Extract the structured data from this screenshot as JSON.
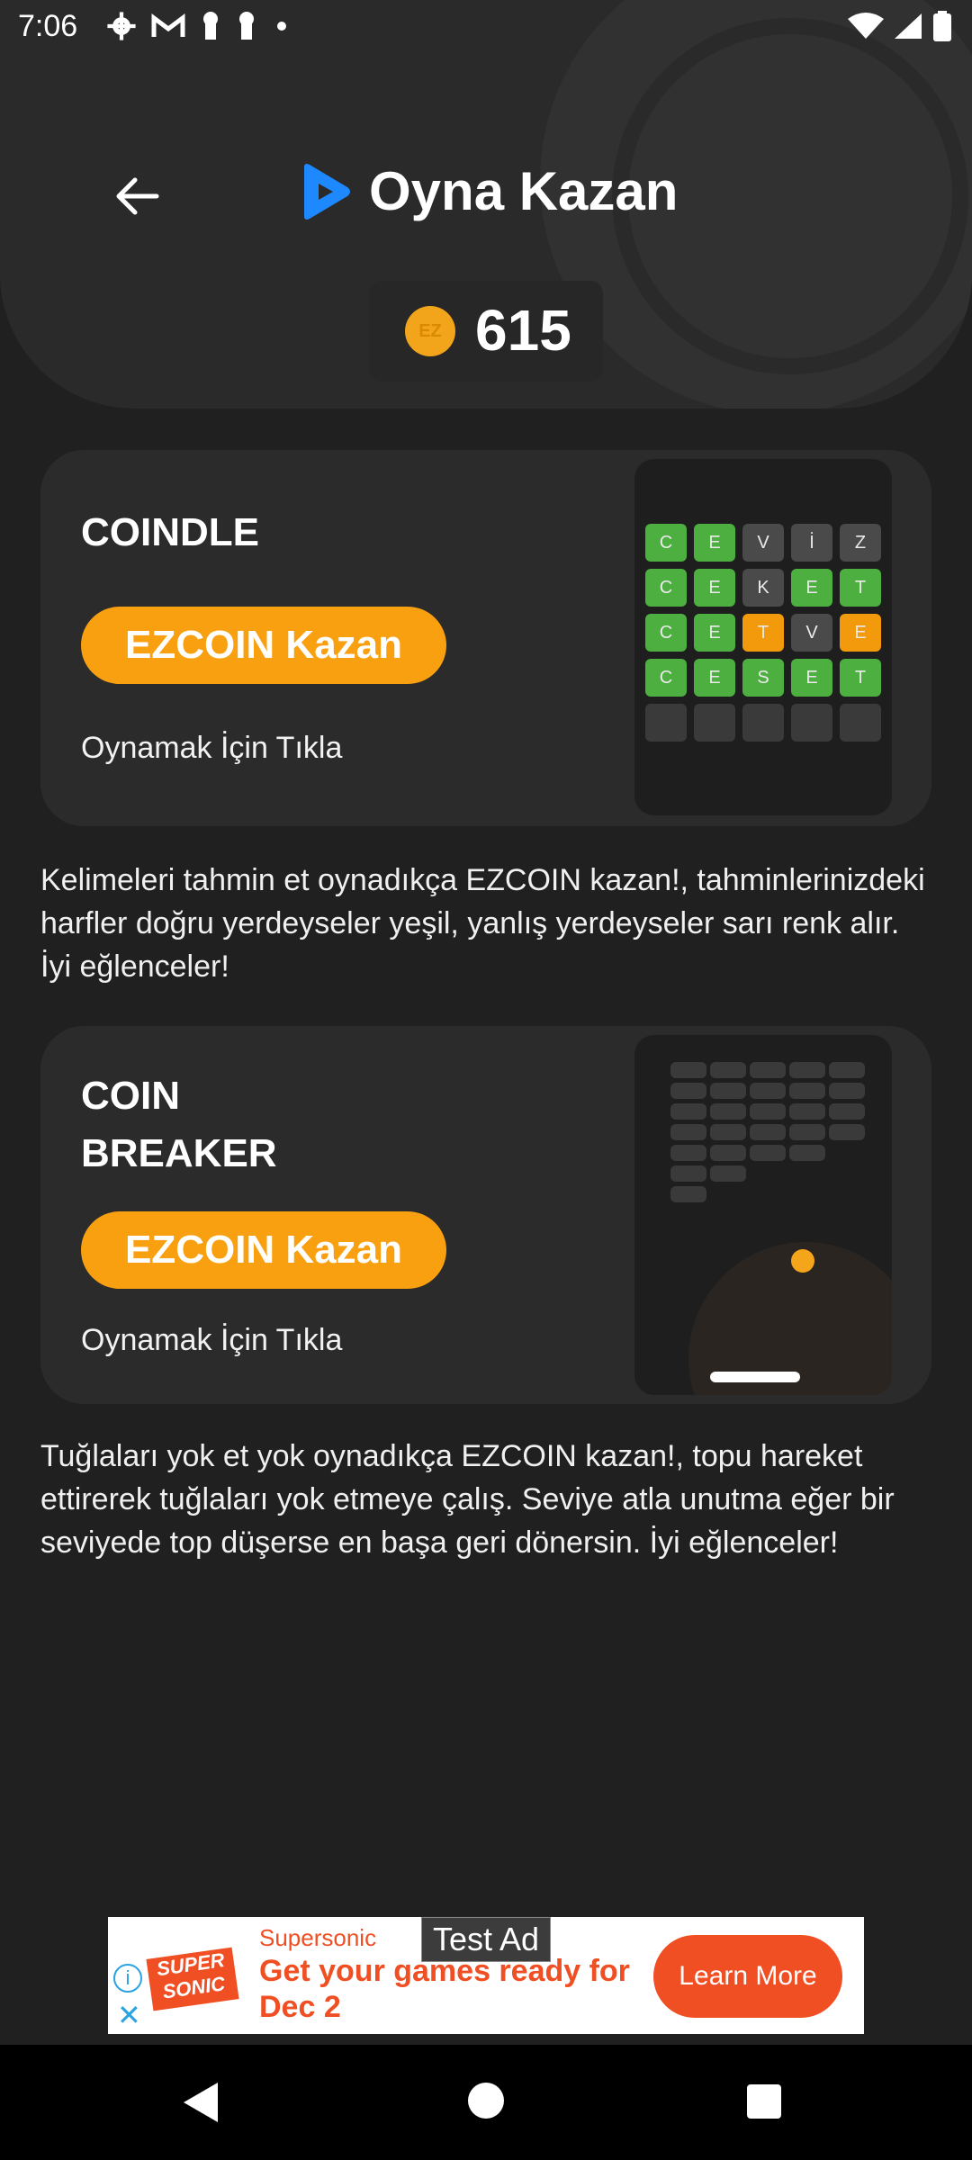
{
  "status_bar": {
    "time": "7:06",
    "left_icons": [
      "settings-icon",
      "gmail-icon",
      "keyhole-icon",
      "keyhole-icon",
      "dot-icon"
    ],
    "right_icons": [
      "wifi-icon",
      "signal-icon",
      "battery-icon"
    ]
  },
  "header": {
    "title": "Oyna Kazan",
    "balance": "615",
    "coin_label": "EZ",
    "accent": "#1e88ff"
  },
  "games": [
    {
      "title": "COINDLE",
      "button": "EZCOIN Kazan",
      "hint": "Oynamak İçin Tıkla",
      "description": "Kelimeleri tahmin et oynadıkça EZCOIN kazan!, tahminlerinizdeki harfler doğru yerdeyseler yeşil, yanlış yerdeyseler sarı renk alır. İyi eğlenceler!",
      "grid": [
        [
          {
            "l": "C",
            "s": "g"
          },
          {
            "l": "E",
            "s": "g"
          },
          {
            "l": "V",
            "s": "n"
          },
          {
            "l": "İ",
            "s": "n"
          },
          {
            "l": "Z",
            "s": "n"
          }
        ],
        [
          {
            "l": "C",
            "s": "g"
          },
          {
            "l": "E",
            "s": "g"
          },
          {
            "l": "K",
            "s": "n"
          },
          {
            "l": "E",
            "s": "g"
          },
          {
            "l": "T",
            "s": "g"
          }
        ],
        [
          {
            "l": "C",
            "s": "g"
          },
          {
            "l": "E",
            "s": "g"
          },
          {
            "l": "T",
            "s": "y"
          },
          {
            "l": "V",
            "s": "n"
          },
          {
            "l": "E",
            "s": "y"
          }
        ],
        [
          {
            "l": "C",
            "s": "g"
          },
          {
            "l": "E",
            "s": "g"
          },
          {
            "l": "S",
            "s": "g"
          },
          {
            "l": "E",
            "s": "g"
          },
          {
            "l": "T",
            "s": "g"
          }
        ],
        [
          {
            "l": "",
            "s": "e"
          },
          {
            "l": "",
            "s": "e"
          },
          {
            "l": "",
            "s": "e"
          },
          {
            "l": "",
            "s": "e"
          },
          {
            "l": "",
            "s": "e"
          }
        ]
      ]
    },
    {
      "title": "COIN\nBREAKER",
      "button": "EZCOIN Kazan",
      "hint": "Oynamak İçin Tıkla",
      "description": "Tuğlaları yok et yok oynadıkça EZCOIN kazan!, topu hareket ettirerek tuğlaları yok etmeye çalış. Seviye atla unutma eğer bir seviyede top düşerse en başa geri dönersin. İyi eğlenceler!"
    }
  ],
  "ad": {
    "label": "Test Ad",
    "advertiser": "Supersonic",
    "headline": "Get your games ready for Dec 2",
    "cta": "Learn More",
    "logo_text": "SUPER SONIC",
    "info_symbol": "i",
    "close_symbol": "✕"
  }
}
